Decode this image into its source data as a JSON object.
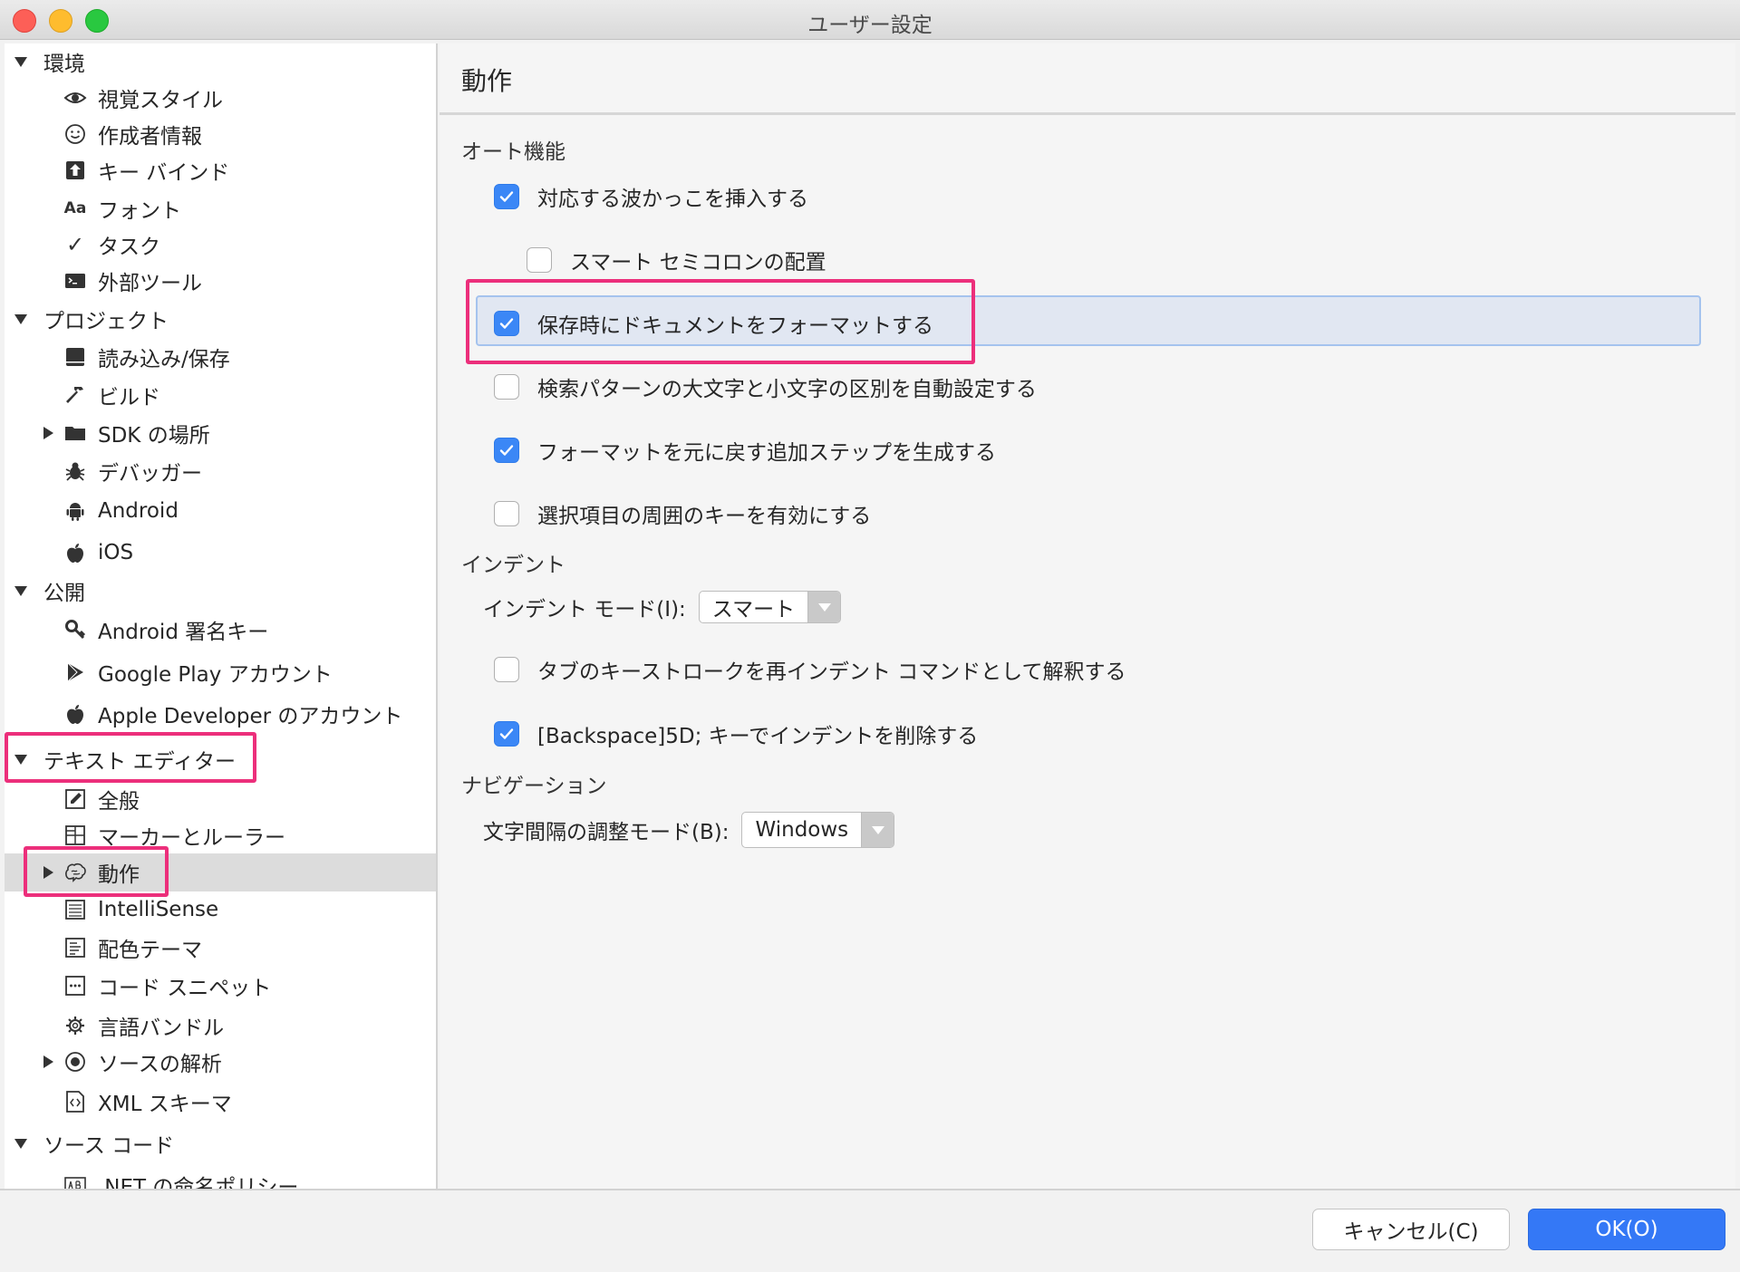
{
  "window": {
    "title": "ユーザー設定"
  },
  "sidebar": {
    "groups": [
      {
        "label": "環境",
        "items": [
          {
            "label": "視覚スタイル",
            "icon": "eye-icon"
          },
          {
            "label": "作成者情報",
            "icon": "smiley-icon"
          },
          {
            "label": "キー バインド",
            "icon": "key-binding-icon"
          },
          {
            "label": "フォント",
            "icon": "font-icon",
            "glyph": "Aa"
          },
          {
            "label": "タスク",
            "icon": "checkmark-icon",
            "glyph": "✓"
          },
          {
            "label": "外部ツール",
            "icon": "terminal-icon"
          }
        ]
      },
      {
        "label": "プロジェクト",
        "items": [
          {
            "label": "読み込み/保存",
            "icon": "drive-icon"
          },
          {
            "label": "ビルド",
            "icon": "hammer-icon"
          },
          {
            "label": "SDK の場所",
            "icon": "folder-icon"
          },
          {
            "label": "デバッガー",
            "icon": "bug-icon"
          },
          {
            "label": "Android",
            "icon": "android-icon"
          },
          {
            "label": "iOS",
            "icon": "apple-icon"
          }
        ]
      },
      {
        "label": "公開",
        "items": [
          {
            "label": "Android 署名キー",
            "icon": "key-icon"
          },
          {
            "label": "Google Play アカウント",
            "icon": "play-icon"
          },
          {
            "label": "Apple Developer のアカウント",
            "icon": "apple-icon"
          }
        ]
      },
      {
        "label": "テキスト エディター",
        "items": [
          {
            "label": "全般",
            "icon": "edit-icon"
          },
          {
            "label": "マーカーとルーラー",
            "icon": "grid-icon"
          },
          {
            "label": "動作",
            "icon": "brain-icon"
          },
          {
            "label": "IntelliSense",
            "icon": "list-icon"
          },
          {
            "label": "配色テーマ",
            "icon": "document-icon"
          },
          {
            "label": "コード スニペット",
            "icon": "snippet-icon"
          },
          {
            "label": "言語バンドル",
            "icon": "gear-icon"
          },
          {
            "label": "ソースの解析",
            "icon": "radio-icon"
          },
          {
            "label": "XML スキーマ",
            "icon": "xml-icon"
          }
        ]
      },
      {
        "label": "ソース コード",
        "items": [
          {
            "label": ".NET の命名ポリシー",
            "icon": "naming-icon"
          }
        ]
      }
    ]
  },
  "main": {
    "title": "動作",
    "sections": {
      "auto": {
        "title": "オート機能",
        "options": [
          {
            "label": "対応する波かっこを挿入する",
            "checked": true
          },
          {
            "label": "スマート セミコロンの配置",
            "checked": false
          },
          {
            "label": "保存時にドキュメントをフォーマットする",
            "checked": true
          },
          {
            "label": "検索パターンの大文字と小文字の区別を自動設定する",
            "checked": false
          },
          {
            "label": "フォーマットを元に戻す追加ステップを生成する",
            "checked": true
          },
          {
            "label": "選択項目の周囲のキーを有効にする",
            "checked": false
          }
        ]
      },
      "indent": {
        "title": "インデント",
        "mode_label": "インデント モード(I):",
        "mode_value": "スマート",
        "options": [
          {
            "label": "タブのキーストロークを再インデント コマンドとして解釈する",
            "checked": false
          },
          {
            "label": "[Backspace]5D; キーでインデントを削除する",
            "checked": true
          }
        ]
      },
      "navigation": {
        "title": "ナビゲーション",
        "spacing_label": "文字間隔の調整モード(B):",
        "spacing_value": "Windows"
      }
    }
  },
  "footer": {
    "cancel_label": "キャンセル(C)",
    "ok_label": "OK(O)"
  },
  "colors": {
    "accent": "#3478f6",
    "highlight": "#ec2f7b",
    "checkbox": "#3b87f6"
  }
}
